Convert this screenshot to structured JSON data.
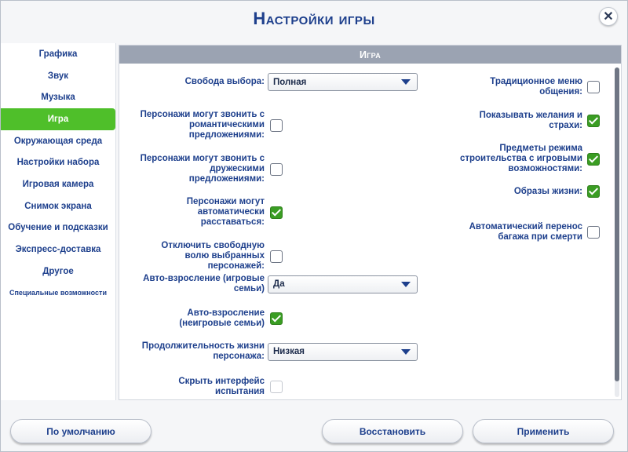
{
  "window": {
    "title": "Настройки игры",
    "close_icon": "close-icon"
  },
  "sidebar": {
    "items": [
      {
        "label": "Графика"
      },
      {
        "label": "Звук"
      },
      {
        "label": "Музыка"
      },
      {
        "label": "Игра"
      },
      {
        "label": "Окружающая среда"
      },
      {
        "label": "Настройки набора"
      },
      {
        "label": "Игровая камера"
      },
      {
        "label": "Снимок экрана"
      },
      {
        "label": "Обучение и подсказки"
      },
      {
        "label": "Экспресс-доставка"
      },
      {
        "label": "Другое"
      },
      {
        "label": "Специальные возможности"
      }
    ],
    "active_color": "#4fbf2a"
  },
  "panel": {
    "header": "Игра",
    "left": {
      "free_will": {
        "label": "Свобода выбора:",
        "value": "Полная"
      },
      "romantic_calls": {
        "label": "Персонажи могут звонить с романтическими предложениями:",
        "checked": false
      },
      "friendly_calls": {
        "label": "Персонажи могут звонить с дружескими предложениями:",
        "checked": false
      },
      "auto_seat": {
        "label": "Персонажи могут автоматически расставаться:",
        "checked": true
      },
      "disable_autonomy": {
        "label": "Отключить свободную волю выбранных персонажей:",
        "checked": false
      },
      "aging_played": {
        "label": "Авто-взросление (игровые семьи)",
        "value": "Да"
      },
      "aging_unplayed": {
        "label": "Авто-взросление (неигровые семьи)",
        "checked": true
      },
      "lifespan": {
        "label": "Продолжительность жизни персонажа:",
        "value": "Низкая"
      },
      "hide_challenge": {
        "label": "Скрыть интерфейс испытания",
        "checked": false
      }
    },
    "right": {
      "classic_menu": {
        "label": "Традиционное меню общения:",
        "checked": false
      },
      "wants_fears": {
        "label": "Показывать желания и страхи:",
        "checked": true
      },
      "build_items": {
        "label": "Предметы режима строительства с игровыми возможностями:",
        "checked": true
      },
      "lifestyles": {
        "label": "Образы жизни:",
        "checked": true
      },
      "inherit_items": {
        "label": "Автоматический перенос багажа при смерти",
        "checked": false
      }
    }
  },
  "footer": {
    "defaults": "По умолчанию",
    "restore": "Восстановить",
    "apply": "Применить"
  },
  "colors": {
    "text_blue": "#1d3f8c",
    "check_green": "#3a9d23",
    "header_gray": "#9ba3b2"
  }
}
